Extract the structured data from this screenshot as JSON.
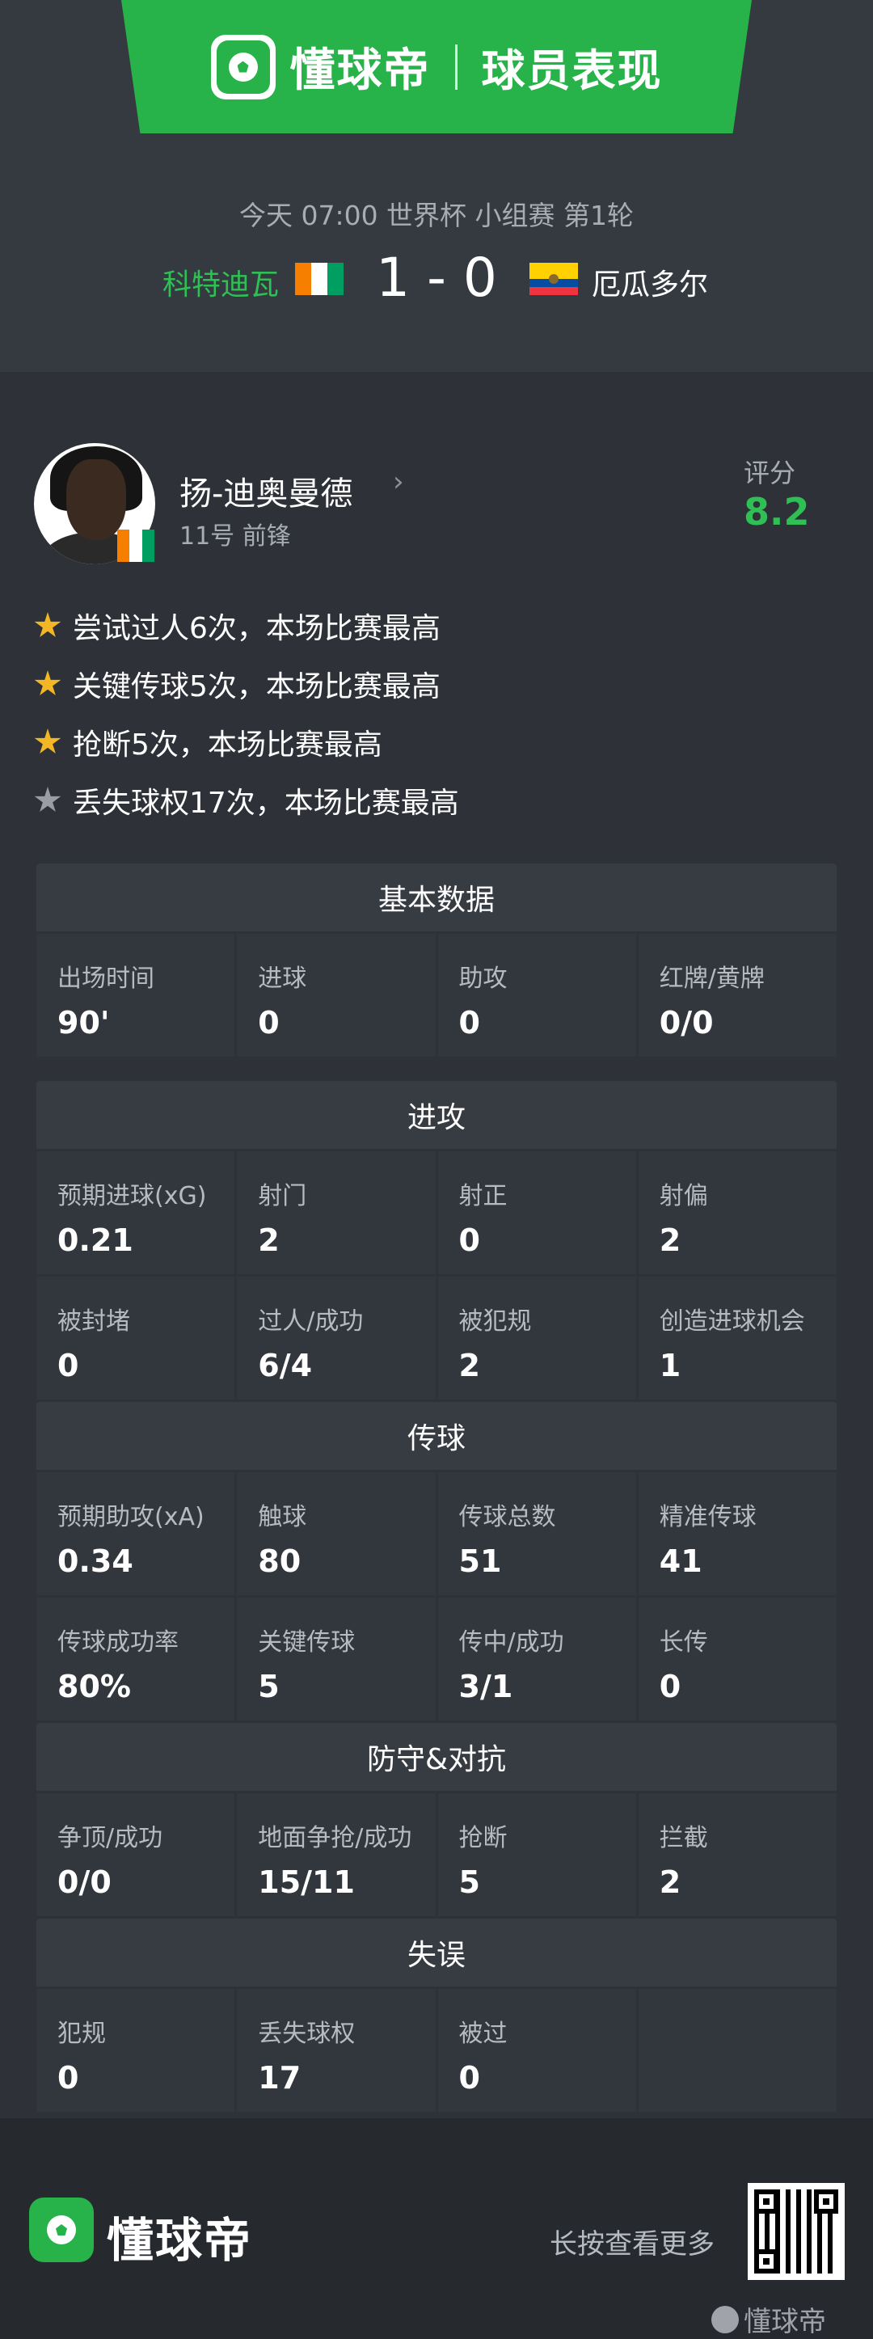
{
  "header": {
    "brand": "懂球帝",
    "title": "球员表现",
    "match_meta": "今天 07:00 世界杯 小组赛 第1轮",
    "home_team": "科特迪瓦",
    "score": "1 - 0",
    "away_team": "厄瓜多尔",
    "home_flag_colors": [
      "#f77f00",
      "#ffffff",
      "#009e60"
    ],
    "away_flag_colors": [
      "#ffd100",
      "#034ea2",
      "#ef3340"
    ]
  },
  "player": {
    "name": "扬-迪奥曼德",
    "sub": "11号 前锋",
    "rating_label": "评分",
    "rating": "8.2",
    "highlights": [
      {
        "text": "尝试过人6次，本场比赛最高",
        "icon": "gold-star-icon"
      },
      {
        "text": "关键传球5次，本场比赛最高",
        "icon": "gold-star-icon"
      },
      {
        "text": "抢断5次，本场比赛最高",
        "icon": "gold-star-icon"
      },
      {
        "text": "丢失球权17次，本场比赛最高",
        "icon": "grey-star-icon"
      }
    ]
  },
  "sections": {
    "basic": {
      "title": "基本数据",
      "cells": [
        {
          "label": "出场时间",
          "value": "90'"
        },
        {
          "label": "进球",
          "value": "0"
        },
        {
          "label": "助攻",
          "value": "0"
        },
        {
          "label": "红牌/黄牌",
          "value": "0/0"
        }
      ]
    },
    "attack": {
      "title": "进攻",
      "cells": [
        {
          "label": "预期进球(xG)",
          "value": "0.21"
        },
        {
          "label": "射门",
          "value": "2"
        },
        {
          "label": "射正",
          "value": "0"
        },
        {
          "label": "射偏",
          "value": "2"
        },
        {
          "label": "被封堵",
          "value": "0"
        },
        {
          "label": "过人/成功",
          "value": "6/4"
        },
        {
          "label": "被犯规",
          "value": "2"
        },
        {
          "label": "创造进球机会",
          "value": "1"
        }
      ]
    },
    "passing": {
      "title": "传球",
      "cells": [
        {
          "label": "预期助攻(xA)",
          "value": "0.34"
        },
        {
          "label": "触球",
          "value": "80"
        },
        {
          "label": "传球总数",
          "value": "51"
        },
        {
          "label": "精准传球",
          "value": "41"
        },
        {
          "label": "传球成功率",
          "value": "80%"
        },
        {
          "label": "关键传球",
          "value": "5"
        },
        {
          "label": "传中/成功",
          "value": "3/1"
        },
        {
          "label": "长传",
          "value": "0"
        }
      ]
    },
    "defense": {
      "title": "防守&对抗",
      "cells": [
        {
          "label": "争顶/成功",
          "value": "0/0"
        },
        {
          "label": "地面争抢/成功",
          "value": "15/11"
        },
        {
          "label": "抢断",
          "value": "5"
        },
        {
          "label": "拦截",
          "value": "2"
        }
      ]
    },
    "errors": {
      "title": "失误",
      "cells": [
        {
          "label": "犯规",
          "value": "0"
        },
        {
          "label": "丢失球权",
          "value": "17"
        },
        {
          "label": "被过",
          "value": "0"
        }
      ]
    }
  },
  "footer": {
    "brand": "懂球帝",
    "hint": "长按查看更多",
    "watermark": "懂球帝"
  },
  "colors": {
    "accent_green": "#27b24a",
    "rating_green": "#2fbf54",
    "star_gold": "#f3b624"
  }
}
